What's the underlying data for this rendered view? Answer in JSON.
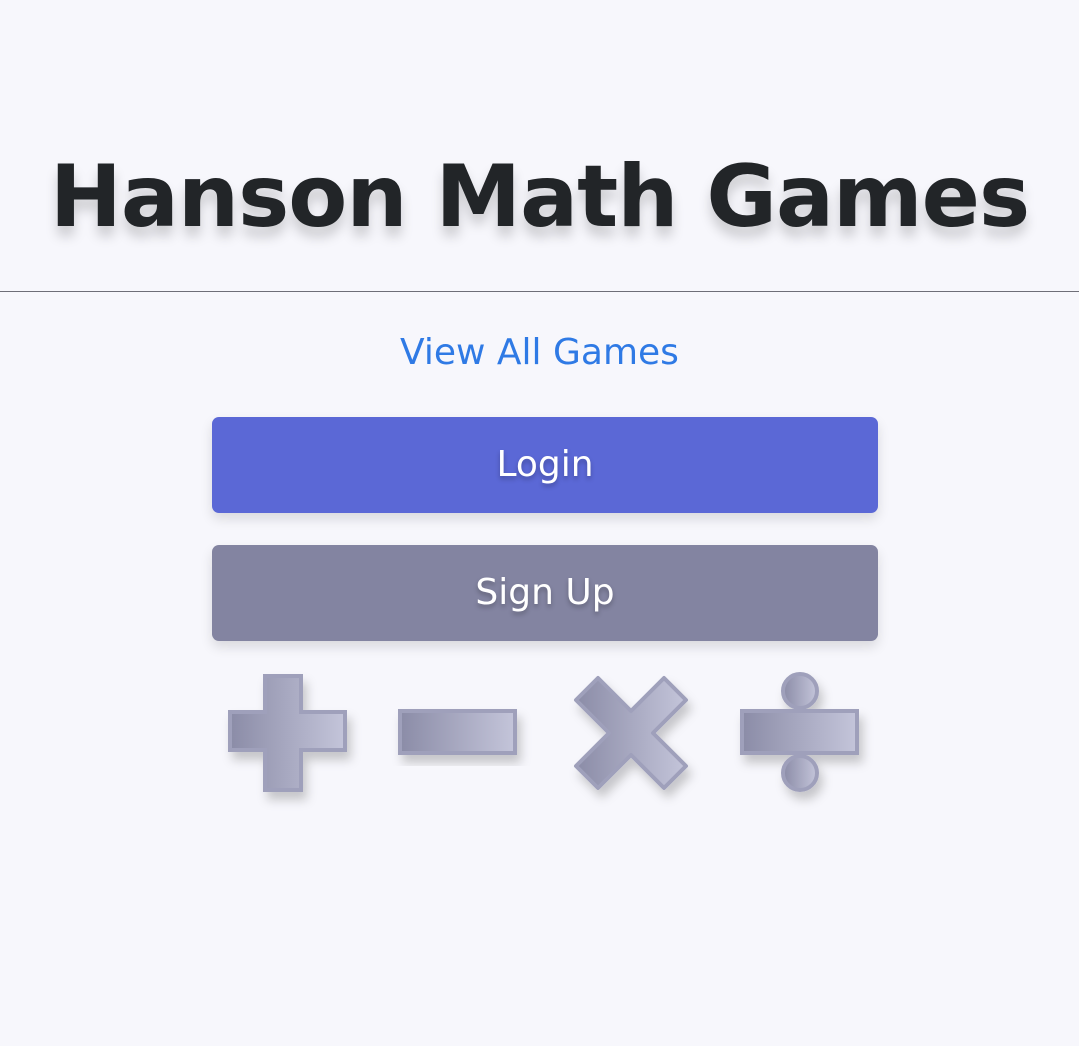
{
  "header": {
    "title": "Hanson Math Games"
  },
  "nav": {
    "view_all_label": "View All Games"
  },
  "actions": {
    "login_label": "Login",
    "signup_label": "Sign Up"
  },
  "decorations": {
    "symbols": [
      "plus-icon",
      "minus-icon",
      "times-icon",
      "divide-icon"
    ]
  },
  "colors": {
    "background": "#f7f7fc",
    "title": "#222528",
    "link": "#2f7ae5",
    "login_button": "#5b68d6",
    "signup_button": "#8384a1",
    "symbol_light": "#c4c5da",
    "symbol_dark": "#8b8ca7"
  }
}
